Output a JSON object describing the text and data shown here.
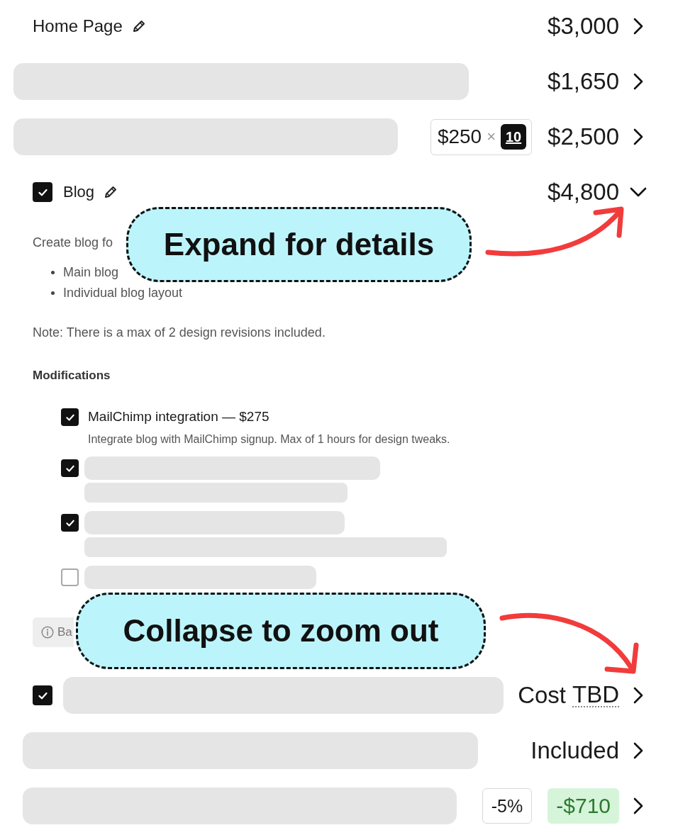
{
  "line_items": [
    {
      "kind": "named",
      "title": "Home Page",
      "editable": true,
      "price": {
        "kind": "amount",
        "text": "$3,000"
      },
      "expanded": false
    },
    {
      "kind": "loading",
      "price": {
        "kind": "amount",
        "text": "$1,650"
      },
      "expanded": false
    },
    {
      "kind": "loading",
      "quantity": {
        "unit_price": "$250",
        "sign": "×",
        "count": "10"
      },
      "price": {
        "kind": "amount",
        "text": "$2,500"
      },
      "expanded": false
    },
    {
      "kind": "named",
      "checkbox": {
        "checked": true
      },
      "title": "Blog",
      "editable": true,
      "price": {
        "kind": "amount",
        "text": "$4,800"
      },
      "expanded": true,
      "details": {
        "description": "Create blog fo",
        "bullets": [
          "Main blog",
          "Individual blog layout"
        ],
        "note": "Note: There is a max of 2 design revisions included.",
        "modifications_heading": "Modifications",
        "modifications": [
          {
            "kind": "text",
            "checked": true,
            "title": "MailChimp integration — $275",
            "description": "Integrate blog with MailChimp signup. Max of 1 hours for design tweaks."
          },
          {
            "kind": "skeleton_two_line",
            "checked": true
          },
          {
            "kind": "skeleton_two_line",
            "checked": true
          },
          {
            "kind": "skeleton_one_line",
            "checked": false
          }
        ],
        "info": "Ba"
      }
    },
    {
      "kind": "loading",
      "checkbox": {
        "checked": true
      },
      "price": {
        "kind": "tbd",
        "text": "Cost",
        "abbr": "TBD"
      },
      "expanded": false
    },
    {
      "kind": "loading",
      "price": {
        "kind": "amount",
        "text": "Included"
      },
      "expanded": false
    },
    {
      "kind": "loading",
      "discount": "-5%",
      "price": {
        "kind": "credit",
        "text": "-$710"
      },
      "expanded": false
    }
  ],
  "callouts": [
    {
      "text": "Expand for details"
    },
    {
      "text": "Collapse to zoom out"
    }
  ]
}
